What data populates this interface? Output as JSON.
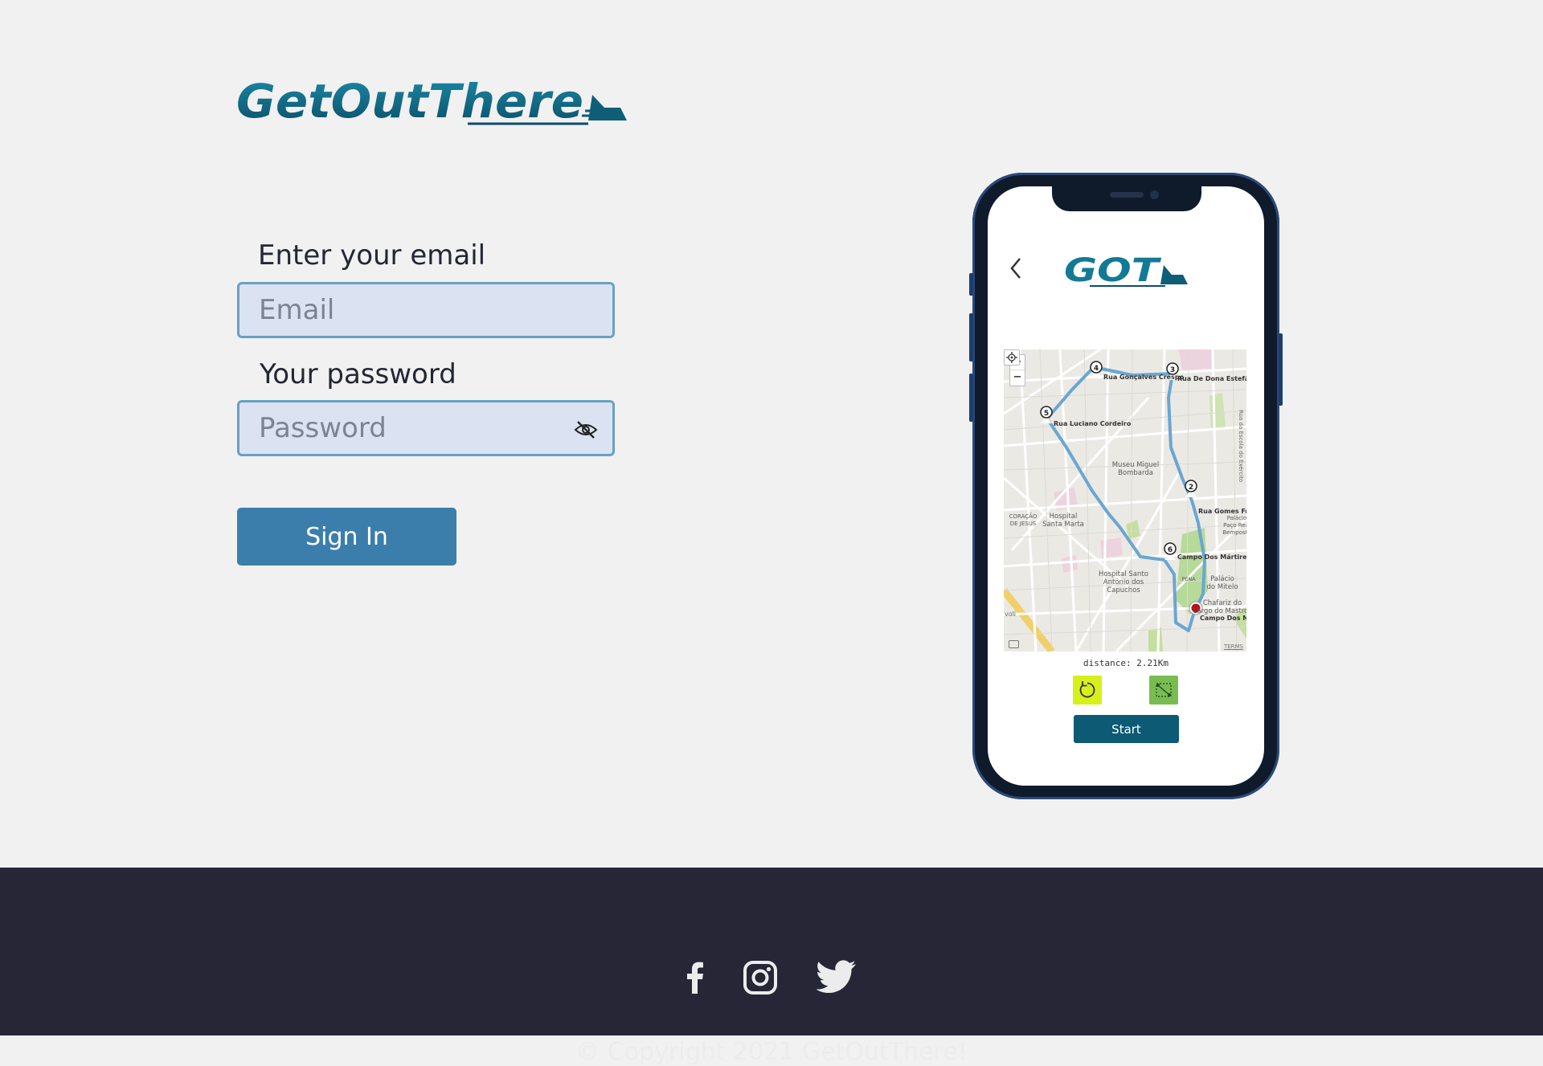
{
  "brand": {
    "name": "GetOutThere",
    "short": "GOT",
    "color": "#0e5e78"
  },
  "login": {
    "email_label": "Enter your email",
    "email_placeholder": "Email",
    "password_label": "Your password",
    "password_placeholder": "Password",
    "sign_in_label": "Sign In",
    "accent_color": "#3b7eac"
  },
  "phone": {
    "distance_text": "distance: 2.21Km",
    "start_label": "Start",
    "map": {
      "zoom_in": "+",
      "zoom_out": "−",
      "terms": "TERMS",
      "streets": {
        "s1": "Rua Gonçalves Crespo",
        "s2": "Rua De Dona Estefânia",
        "s3": "Rua Luciano Cordeiro",
        "s4": "Rua Gomes Freire",
        "s5": "Campo Dos Mártires",
        "s6": "Campo Dos Mártires",
        "s7": "Rua da Escola do Exército"
      },
      "places": {
        "p1": "Museu Miguel",
        "p1b": "Bombarda",
        "p2": "Hospital",
        "p2b": "Santa Marta",
        "p3": "Hospital Santo",
        "p3b": "António dos",
        "p3c": "Capuchos",
        "p4": "Palácio",
        "p4b": "do Mitelo",
        "p5": "Chafariz do",
        "p5b": "Largo do Mastro",
        "p6": "CORAÇÃO",
        "p6b": "DE JESUS",
        "p7": "Palácio",
        "p7b": "Paço Real",
        "p7c": "Bemposta",
        "p8": "PENA",
        "p9": "voli"
      },
      "waypoints": [
        "2",
        "3",
        "4",
        "5",
        "6"
      ]
    },
    "icons": {
      "refresh": "refresh-icon",
      "route": "route-icon"
    },
    "colors": {
      "refresh": "#d7ef1b",
      "route": "#79bd51",
      "start": "#0c5a73",
      "route_line": "#6aa6d2"
    }
  },
  "footer": {
    "copyright": "© Copyright 2021 GetOutThere!",
    "social": [
      "facebook-icon",
      "instagram-icon",
      "twitter-icon"
    ],
    "background": "#262637"
  }
}
